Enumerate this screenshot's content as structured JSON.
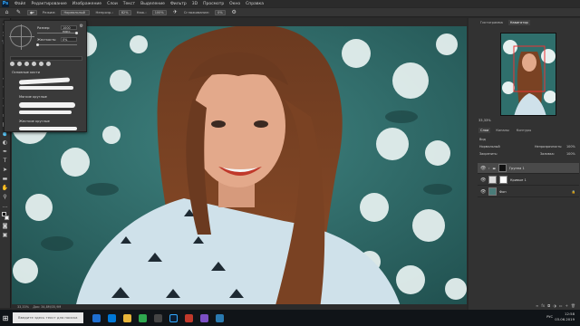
{
  "app": {
    "logo": "Ps",
    "menu": [
      "Файл",
      "Редактирование",
      "Изображение",
      "Слои",
      "Текст",
      "Выделение",
      "Фильтр",
      "3D",
      "Просмотр",
      "Окно",
      "Справка"
    ]
  },
  "options": {
    "mode_label": "Режим:",
    "mode_value": "Нормальный",
    "opacity_label": "Непрозр.:",
    "opacity_value": "82%",
    "flow_label": "Наж.:",
    "flow_value": "100%",
    "smoothing_label": "Сглаживание:",
    "smoothing_value": "0%"
  },
  "brush_panel": {
    "size_label": "Размер:",
    "size_value": "1000 пикс.",
    "hardness_label": "Жесткость:",
    "hardness_value": "0%",
    "folder1": "Основные кисти",
    "folder2": "Мягкие круглые",
    "folder3": "Жесткие круглые"
  },
  "status": {
    "zoom": "33,33%",
    "doc": "Док: 34,8M/35,9M"
  },
  "navigator": {
    "tabs": [
      "Гистограмма",
      "Навигатор"
    ],
    "active_tab": "Навигатор",
    "zoom": "33,33%"
  },
  "layers": {
    "tabs": [
      "Слои",
      "Каналы",
      "Контуры"
    ],
    "active_tab": "Слои",
    "kind_label": "Вид",
    "blend_mode": "Нормальный",
    "opacity_label": "Непрозрачность:",
    "opacity_value": "100%",
    "lock_label": "Закрепить:",
    "fill_label": "Заливка:",
    "fill_value": "100%",
    "items": [
      {
        "name": "Группа 1"
      },
      {
        "name": "Кривые 1"
      },
      {
        "name": "Фон"
      }
    ]
  },
  "taskbar": {
    "search_placeholder": "Введите здесь текст для поиска",
    "lang": "РУС",
    "time": "12:58",
    "date": "03.06.2019"
  },
  "colors": {
    "accent": "#31a8ff",
    "foreground": "#000000",
    "background": "#ffffff"
  }
}
